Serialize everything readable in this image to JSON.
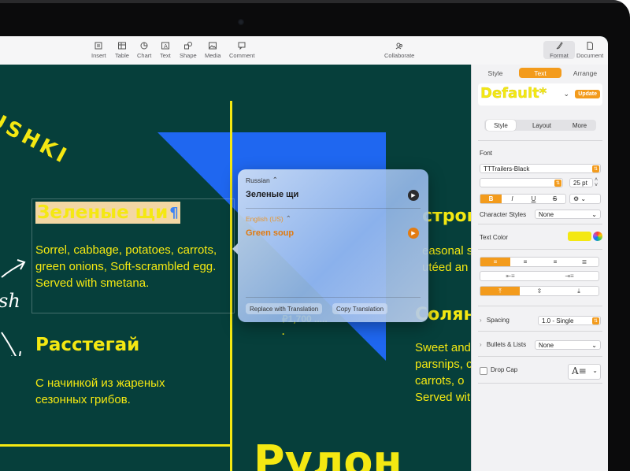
{
  "toolbar": {
    "items": [
      {
        "label": "Insert",
        "icon": "insert-icon"
      },
      {
        "label": "Table",
        "icon": "table-icon"
      },
      {
        "label": "Chart",
        "icon": "chart-icon"
      },
      {
        "label": "Text",
        "icon": "text-icon"
      },
      {
        "label": "Shape",
        "icon": "shape-icon"
      },
      {
        "label": "Media",
        "icon": "media-icon"
      },
      {
        "label": "Comment",
        "icon": "comment-icon"
      }
    ],
    "collaborate": "Collaborate",
    "format": "Format",
    "document": "Document"
  },
  "canvas": {
    "ushki": "USHKI",
    "sh": "sh",
    "dish1": {
      "title": "Зеленые щи",
      "pilcrow": "¶",
      "desc": "Sorrel, cabbage, potatoes, carrots, green onions, Soft-scrambled egg. Served with smetana."
    },
    "dish2": {
      "title": "Расстегай",
      "desc": "С начинкой из жареных сезонных грибов."
    },
    "price": "₽1,700 .....",
    "price_dot": ".",
    "right1": {
      "title": "строга",
      "lines": [
        "easonal s",
        "utéed an"
      ]
    },
    "right2": {
      "title": "Соляні",
      "lines": [
        "Sweet and",
        "parsnips, c",
        "carrots, o",
        "Served wit"
      ]
    },
    "bottom_big": "Рулон"
  },
  "translation": {
    "source_lang": "Russian",
    "source_text": "Зеленые щи",
    "target_lang": "English (US)",
    "target_text": "Green soup",
    "replace_btn": "Replace with Translation",
    "copy_btn": "Copy Translation"
  },
  "inspector": {
    "tabs": [
      "Style",
      "Text",
      "Arrange"
    ],
    "active_tab": "Text",
    "paragraph_style": "Default*",
    "update": "Update",
    "segments": [
      "Style",
      "Layout",
      "More"
    ],
    "font_label": "Font",
    "font_name": "TTTrailers-Black",
    "font_size": "25 pt",
    "bold": "B",
    "italic": "I",
    "underline": "U",
    "strike": "S",
    "char_styles_label": "Character Styles",
    "char_styles_value": "None",
    "text_color_label": "Text Color",
    "text_color": "#f4e812",
    "spacing_label": "Spacing",
    "spacing_value": "1.0 - Single",
    "bullets_label": "Bullets & Lists",
    "bullets_value": "None",
    "dropcap_label": "Drop Cap",
    "accent": "#f39b1c"
  }
}
